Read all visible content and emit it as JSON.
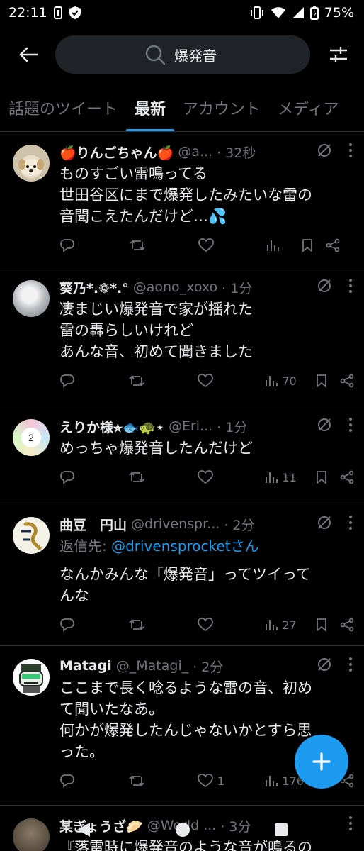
{
  "status_bar": {
    "time": "22:11",
    "battery": "75%"
  },
  "search": {
    "query": "爆発音"
  },
  "tabs": [
    {
      "label": "話題のツイート"
    },
    {
      "label": "最新"
    },
    {
      "label": "アカウント"
    },
    {
      "label": "メディア"
    }
  ],
  "tweets": [
    {
      "name": "🍎りんごちゃん🍎",
      "handle": "@a...",
      "time": "· 32秒",
      "text": "ものすごい雷鳴ってる\n世田谷区にまで爆発したみたいな雷の\n音聞こえたんだけど…💦",
      "likes": "",
      "views": ""
    },
    {
      "name": "葵乃*.❁*.°",
      "handle": "@aono_xoxo",
      "time": "· 1分",
      "text": "凄まじい爆発音で家が揺れた\n雷の轟らしいけれど\nあんな音、初めて聞きました",
      "likes": "",
      "views": "70"
    },
    {
      "name": "えりか様⭐︎🐟🐢⋆",
      "handle": "@Eri...",
      "time": "· 1分",
      "text": "めっちゃ爆発音したんだけど",
      "likes": "",
      "views": "11"
    },
    {
      "name": "曲豆　円山",
      "handle": "@drivenspr...",
      "time": "· 2分",
      "reply_prefix": "返信先: ",
      "reply_mention": "@drivensprocketさん",
      "text": "なんかみんな「爆発音」ってツイって\nんな",
      "likes": "",
      "views": "27"
    },
    {
      "name": "Matagi",
      "handle": "@_Matagi_",
      "time": "· 2分",
      "text": "ここまで長く唸るような雷の音、初め\nて聞いたなあ。\n何かが爆発したんじゃないかとすら思\nった。",
      "likes": "1",
      "views": "176"
    },
    {
      "name": "某ぎょうざ🥟",
      "handle": "@World ...",
      "time": "· 3分",
      "text": "『落雷時に爆発音のような音が鳴るの"
    }
  ]
}
